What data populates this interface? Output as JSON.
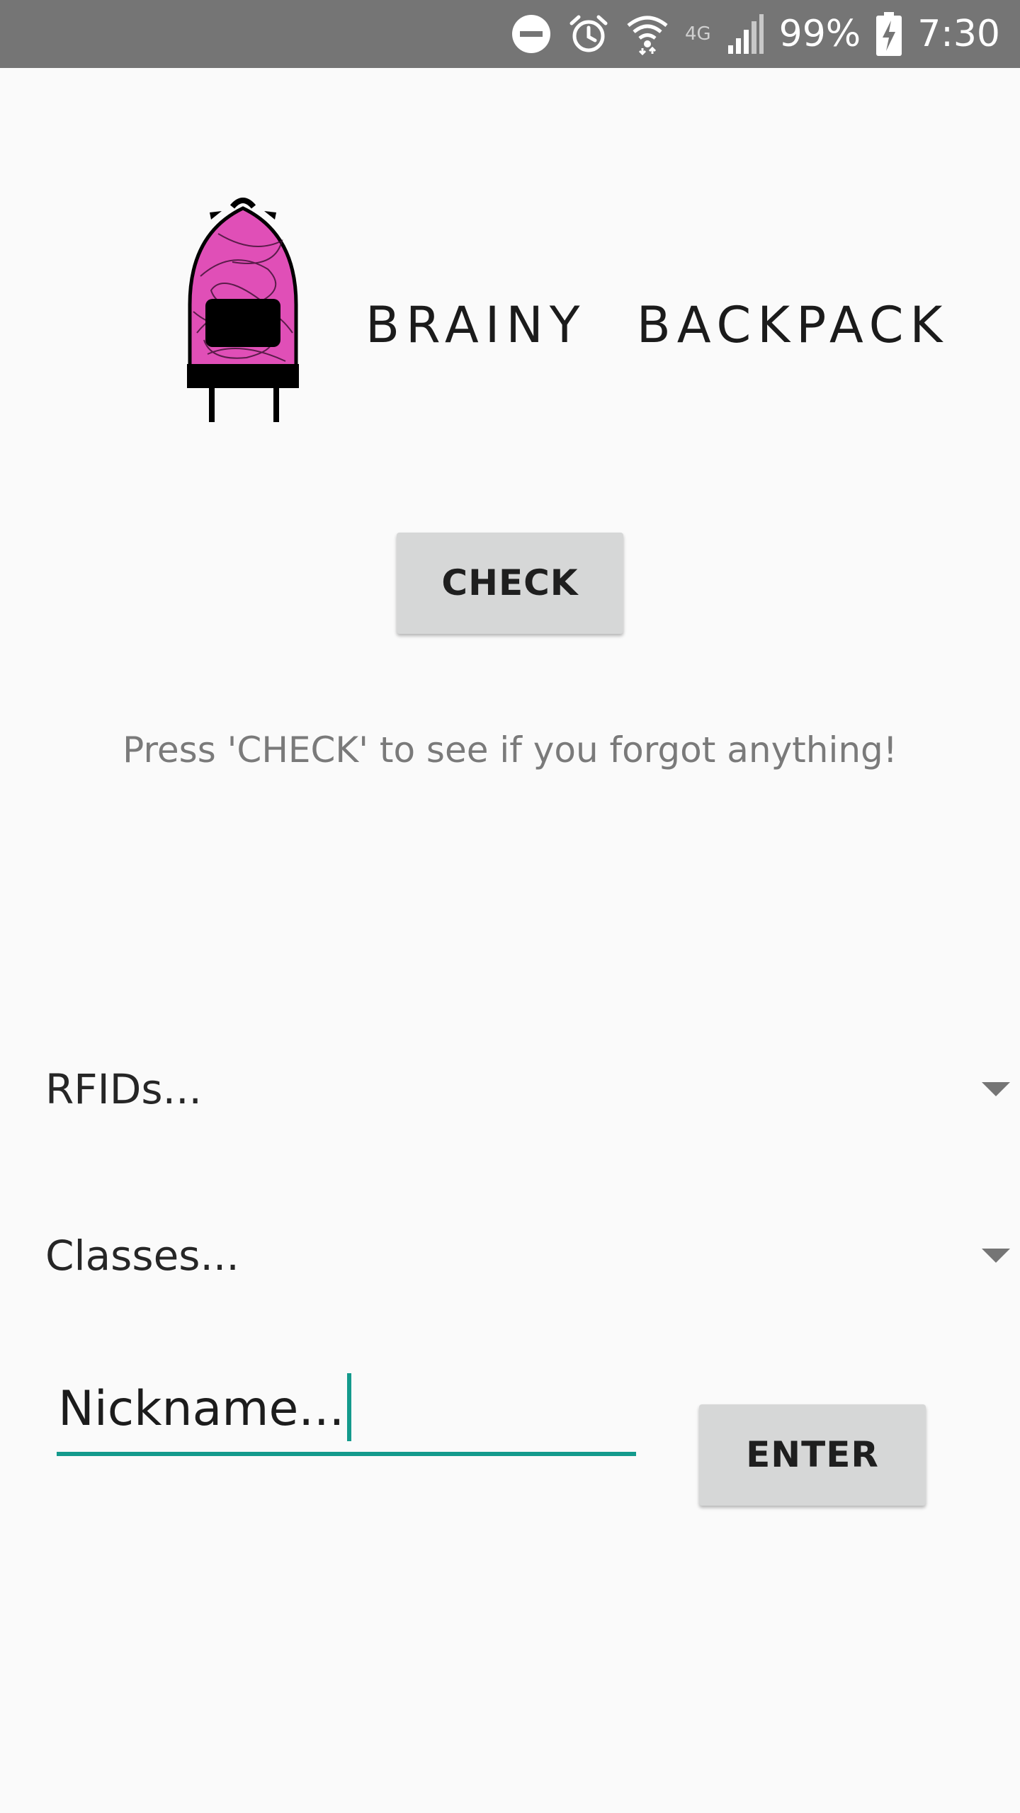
{
  "status_bar": {
    "battery": "99%",
    "time": "7:30",
    "network": "4G",
    "icons": [
      "do-not-disturb-icon",
      "alarm-icon",
      "wifi-icon",
      "signal-icon",
      "battery-charging-icon"
    ]
  },
  "header": {
    "app_name": "BRAINY BACKPACK",
    "logo_icon": "backpack-icon",
    "logo_color": "#e04fb7"
  },
  "check": {
    "button_label": "CHECK",
    "hint": "Press 'CHECK' to see if you forgot anything!"
  },
  "spinners": {
    "rfids": "RFIDs...",
    "classes": "Classes..."
  },
  "nickname": {
    "placeholder": "Nickname...",
    "accent": "#149a8c"
  },
  "enter": {
    "button_label": "ENTER"
  }
}
